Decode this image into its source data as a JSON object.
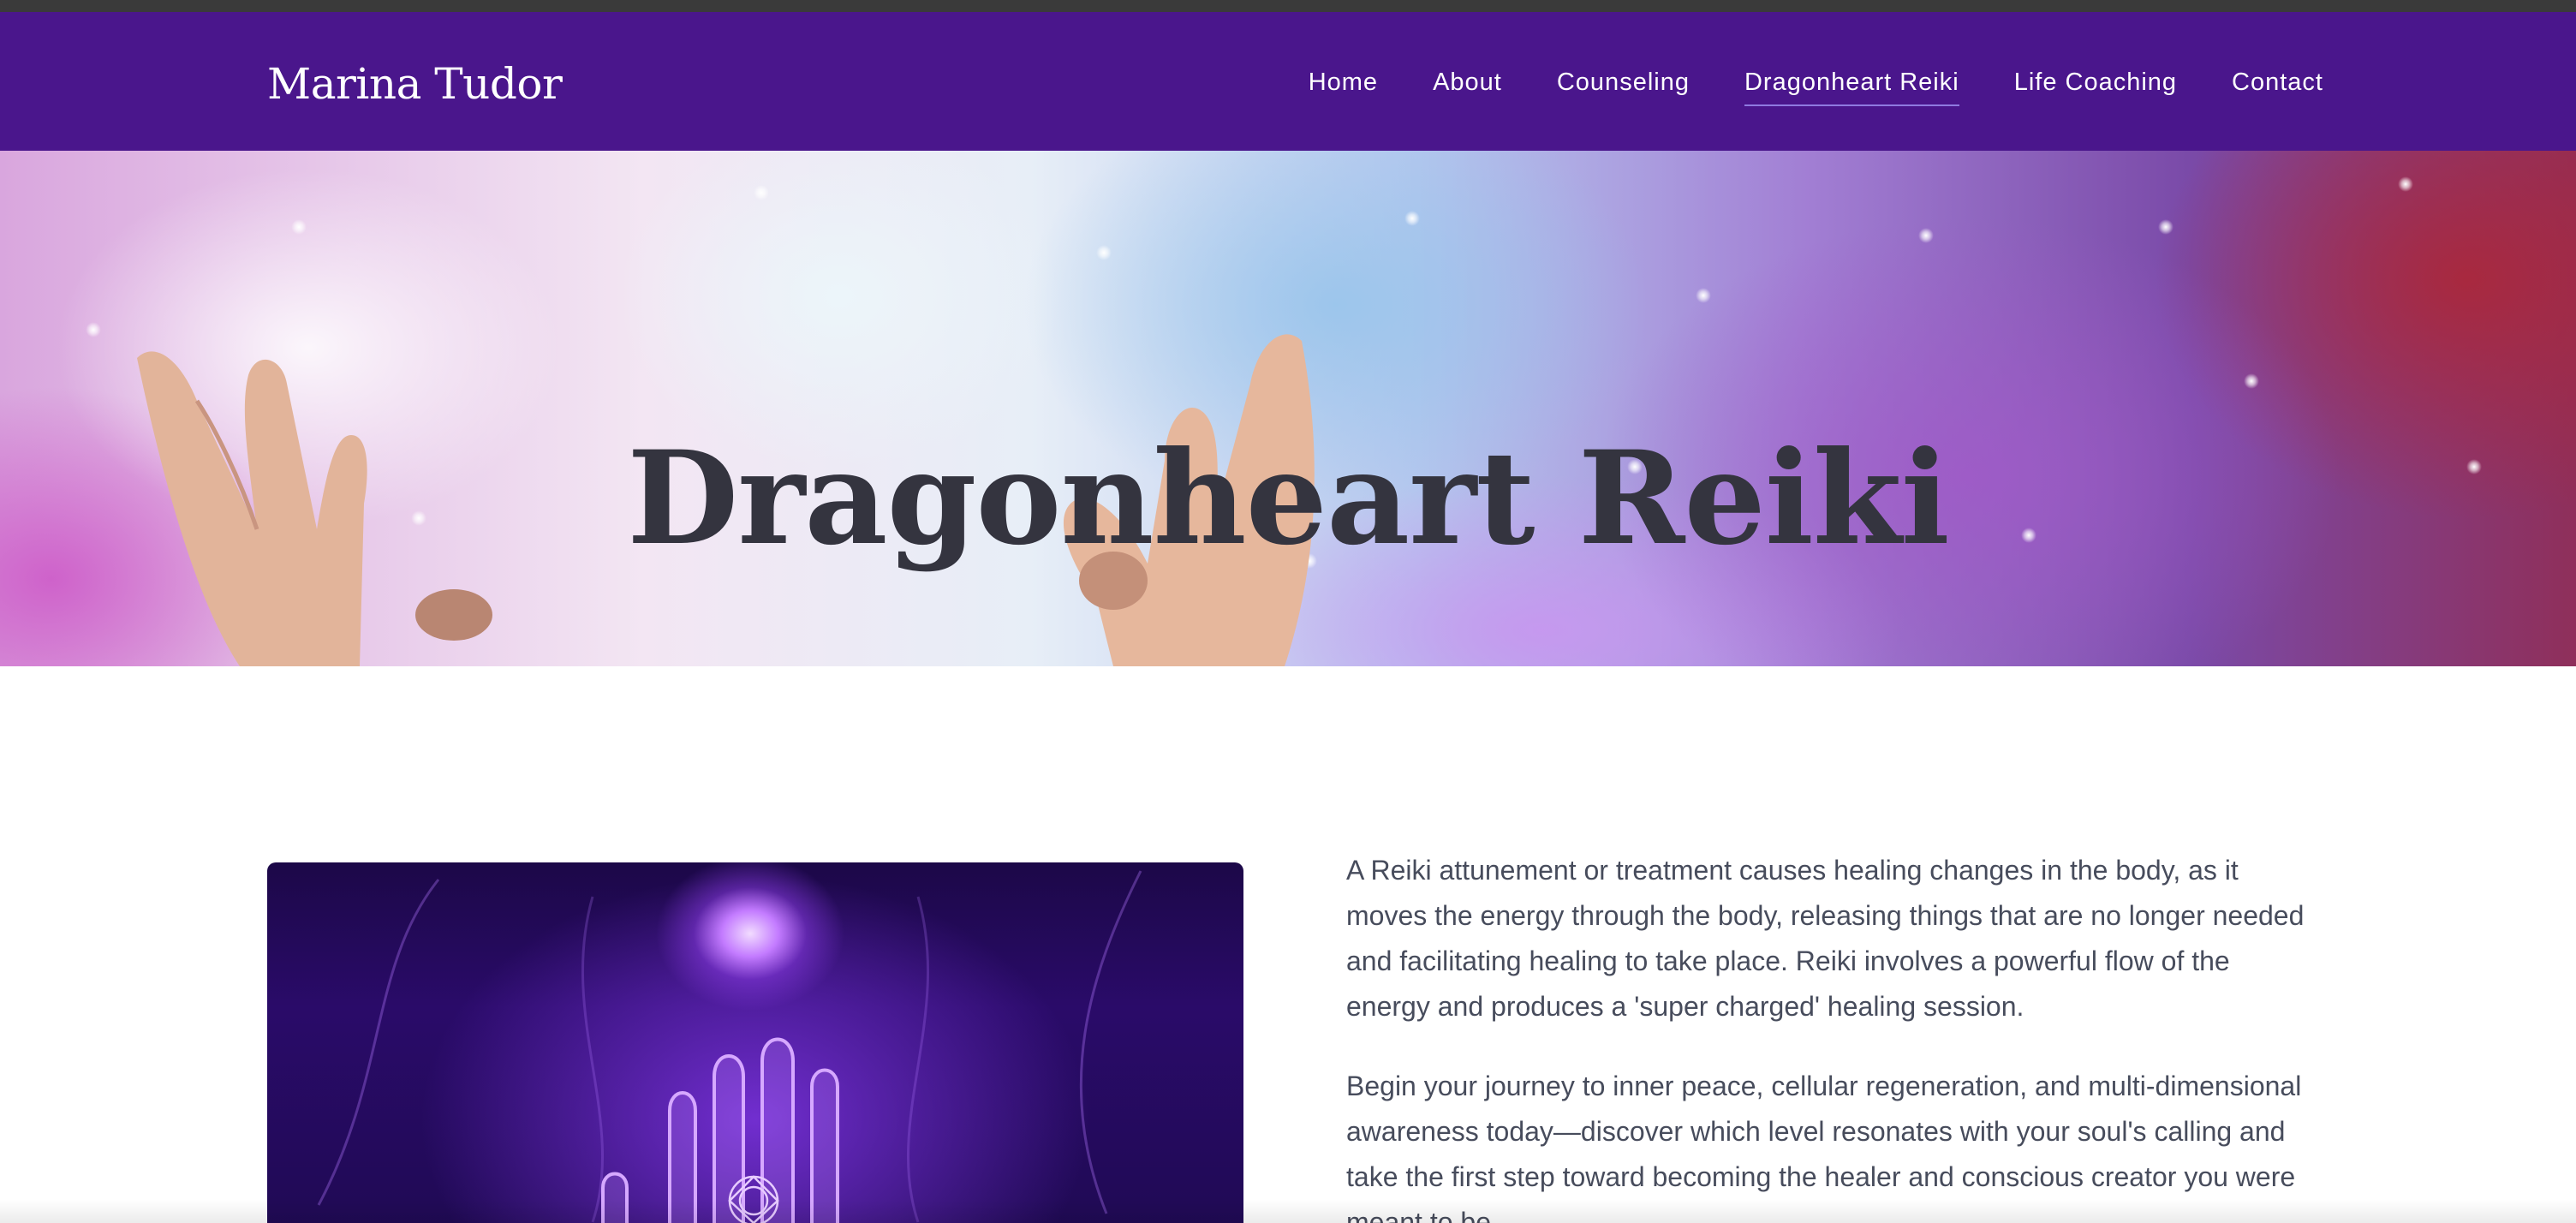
{
  "site": {
    "brand": "Marina Tudor"
  },
  "nav": {
    "items": [
      {
        "label": "Home",
        "active": false
      },
      {
        "label": "About",
        "active": false
      },
      {
        "label": "Counseling",
        "active": false
      },
      {
        "label": "Dragonheart Reiki",
        "active": true
      },
      {
        "label": "Life Coaching",
        "active": false
      },
      {
        "label": "Contact",
        "active": false
      }
    ]
  },
  "hero": {
    "title": "Dragonheart Reiki",
    "image": "hands-raised-to-sparkling-light"
  },
  "content": {
    "image": "glowing-purple-hand-with-chakra-symbol",
    "paragraphs": [
      "A Reiki attunement or treatment causes healing changes in the body, as it moves the energy through the body, releasing things that are no longer needed and facilitating healing to take place. Reiki involves a powerful flow of the energy and produces a 'super charged' healing session.",
      "Begin your journey to inner peace, cellular regeneration, and multi-dimensional awareness today—discover which level resonates with your soul's calling and take the first step toward becoming the healer and conscious creator you were meant to be."
    ]
  },
  "colors": {
    "header_bg": "#4a168c",
    "title_text": "#34343f",
    "body_text": "#474c5c",
    "active_underline": "#8f7ae0"
  }
}
